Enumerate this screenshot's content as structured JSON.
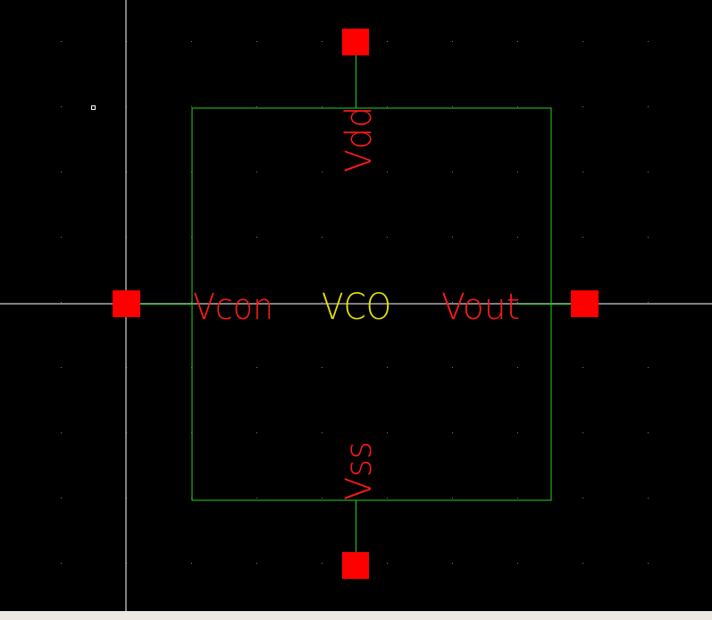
{
  "component": {
    "name": "VCO",
    "pins": {
      "vdd": "Vdd",
      "vss": "Vss",
      "vcon": "Vcon",
      "vout": "Vout"
    }
  },
  "colors": {
    "background": "#000000",
    "grid_dot": "#7a7a7a",
    "crosshair": "#ffffff",
    "symbol_outline": "#22d322",
    "pin_label": "#ff1a1a",
    "instance_label": "#e6e600",
    "pin_marker": "#ff0000",
    "statusbar": "#ece9e2"
  }
}
